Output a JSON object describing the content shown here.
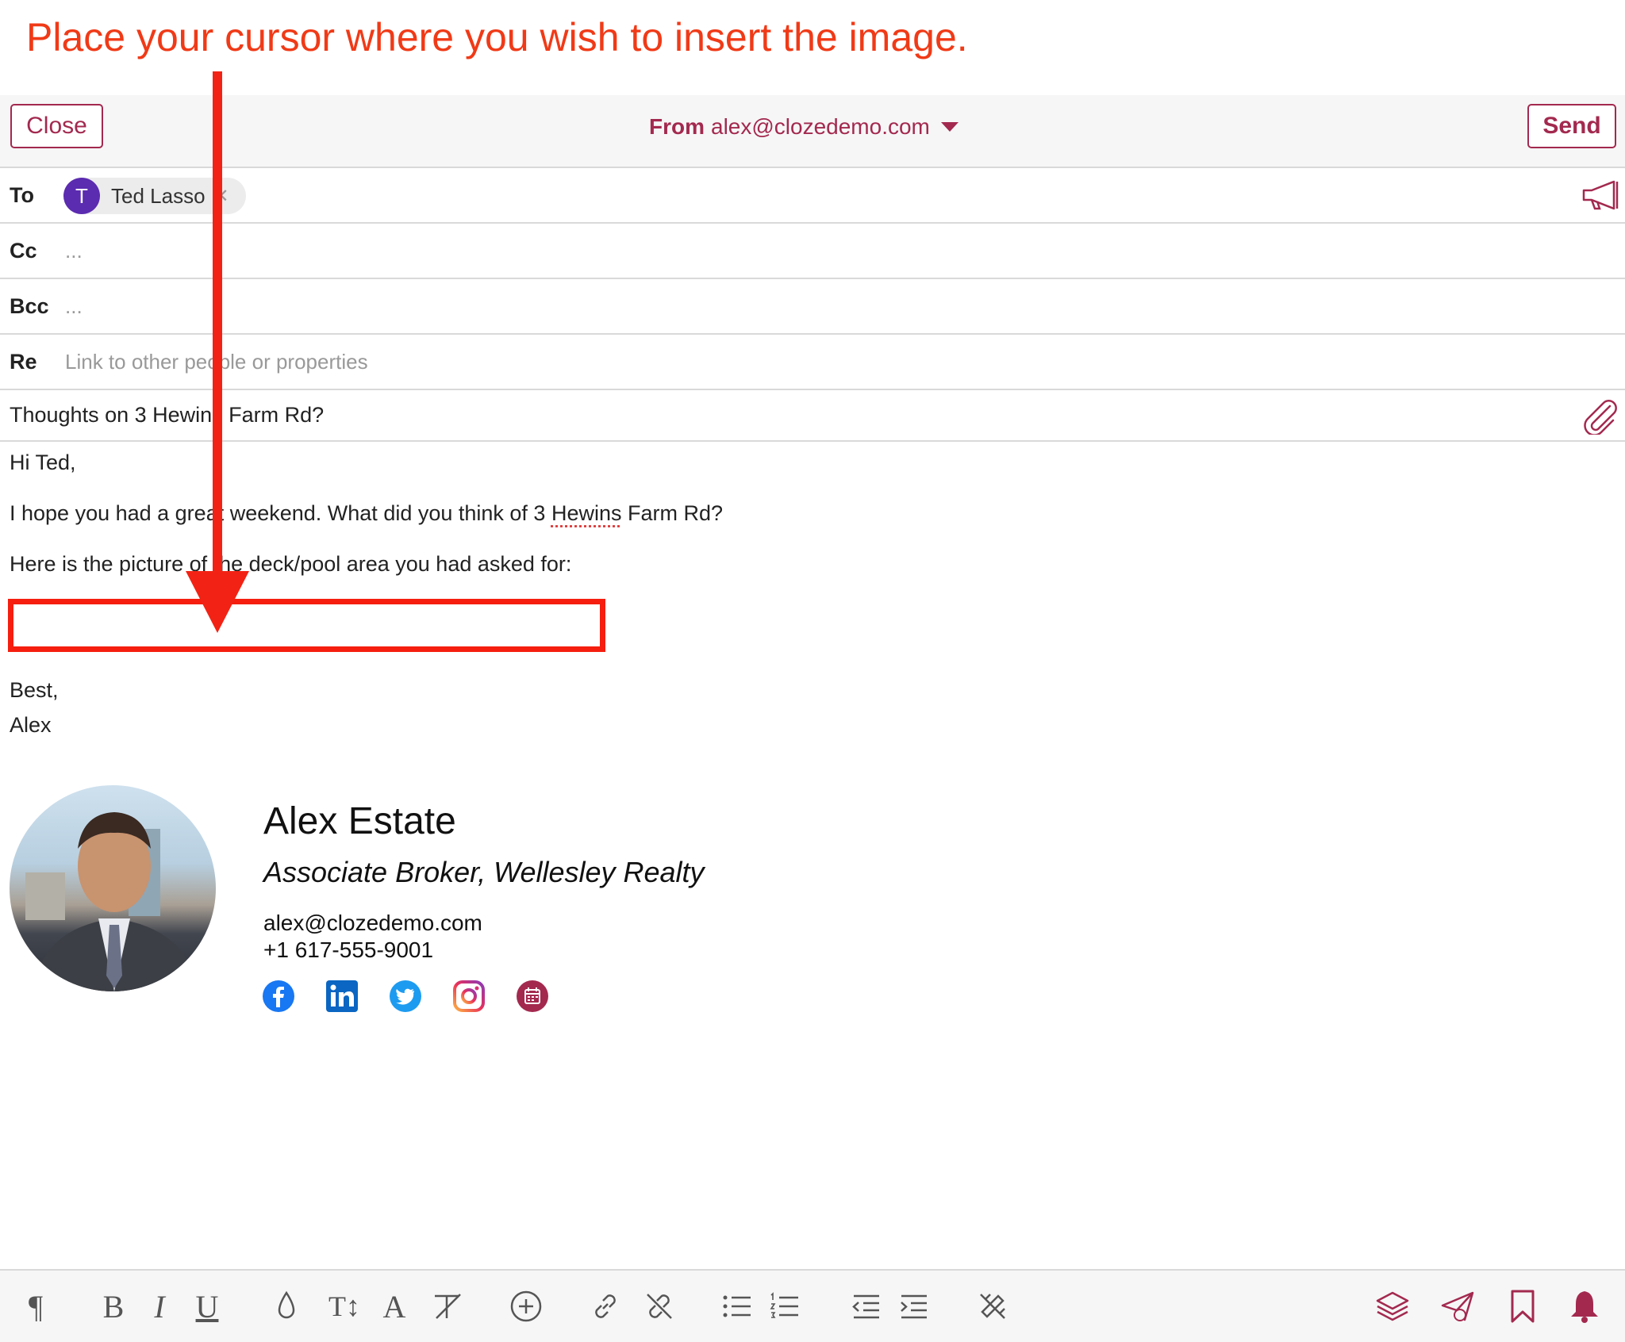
{
  "annotation": {
    "text": "Place your cursor where you wish to insert the image."
  },
  "header": {
    "close_label": "Close",
    "from_label": "From",
    "from_address": "alex@clozedemo.com",
    "send_label": "Send"
  },
  "fields": {
    "to_label": "To",
    "recipient_initial": "T",
    "recipient_name": "Ted Lasso",
    "cc_label": "Cc",
    "cc_value": "...",
    "bcc_label": "Bcc",
    "bcc_value": "...",
    "re_label": "Re",
    "re_placeholder": "Link to other people or properties"
  },
  "subject": "Thoughts on 3 Hewins Farm Rd?",
  "body": {
    "greeting": "Hi Ted,",
    "line1_before": "I hope you had a great weekend. What did you think of 3 ",
    "line1_link": "Hewins",
    "line1_after": " Farm Rd?",
    "line2": "Here is the picture of the deck/pool area you had asked for:",
    "closing": "Best,",
    "sender": "Alex"
  },
  "signature": {
    "name": "Alex Estate",
    "title": "Associate Broker, Wellesley Realty",
    "email": "alex@clozedemo.com",
    "phone": "+1 617-555-9001",
    "social_icons": [
      "facebook-icon",
      "linkedin-icon",
      "twitter-icon",
      "instagram-icon",
      "calendar-icon"
    ]
  },
  "toolbar": {
    "left_icons": [
      "paragraph-icon",
      "bold-icon",
      "italic-icon",
      "underline-icon",
      "color-drop-icon",
      "text-size-icon",
      "font-icon",
      "clear-format-icon",
      "insert-icon",
      "link-icon",
      "unlink-icon",
      "bullet-list-icon",
      "numbered-list-icon",
      "outdent-icon",
      "indent-icon",
      "clear-styles-icon"
    ],
    "right_icons": [
      "layers-icon",
      "send-later-icon",
      "bookmark-icon",
      "bell-icon"
    ]
  },
  "colors": {
    "brand": "#a3294f",
    "annotation": "#f03a17",
    "avatar": "#5b2bb0"
  }
}
